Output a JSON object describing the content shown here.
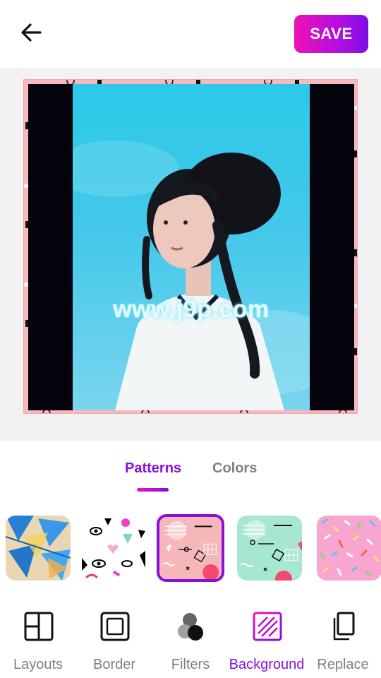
{
  "header": {
    "back_icon": "arrow-left-icon",
    "save_label": "SAVE",
    "save_gradient": [
      "#ec12b4",
      "#7d0de8"
    ]
  },
  "editor": {
    "watermark": "www.j9p.com",
    "frame_color": "#f7b9bd",
    "canvas_background": "#f2f2f2"
  },
  "tabs": {
    "items": [
      {
        "label": "Patterns",
        "active": true
      },
      {
        "label": "Colors",
        "active": false
      }
    ],
    "accent": "#8a0fd9"
  },
  "patterns": [
    {
      "name": "blue-triangles-pattern",
      "selected": false
    },
    {
      "name": "memphis-eyes-pattern",
      "selected": false
    },
    {
      "name": "pink-geometric-pattern",
      "selected": true
    },
    {
      "name": "mint-geometric-pattern",
      "selected": false
    },
    {
      "name": "pink-sprinkles-pattern",
      "selected": false
    }
  ],
  "bottom_nav": {
    "items": [
      {
        "label": "Layouts",
        "icon": "layouts-icon",
        "active": false
      },
      {
        "label": "Border",
        "icon": "border-icon",
        "active": false
      },
      {
        "label": "Filters",
        "icon": "filters-icon",
        "active": false
      },
      {
        "label": "Background",
        "icon": "background-icon",
        "active": true
      },
      {
        "label": "Replace",
        "icon": "replace-icon",
        "active": false
      }
    ]
  }
}
